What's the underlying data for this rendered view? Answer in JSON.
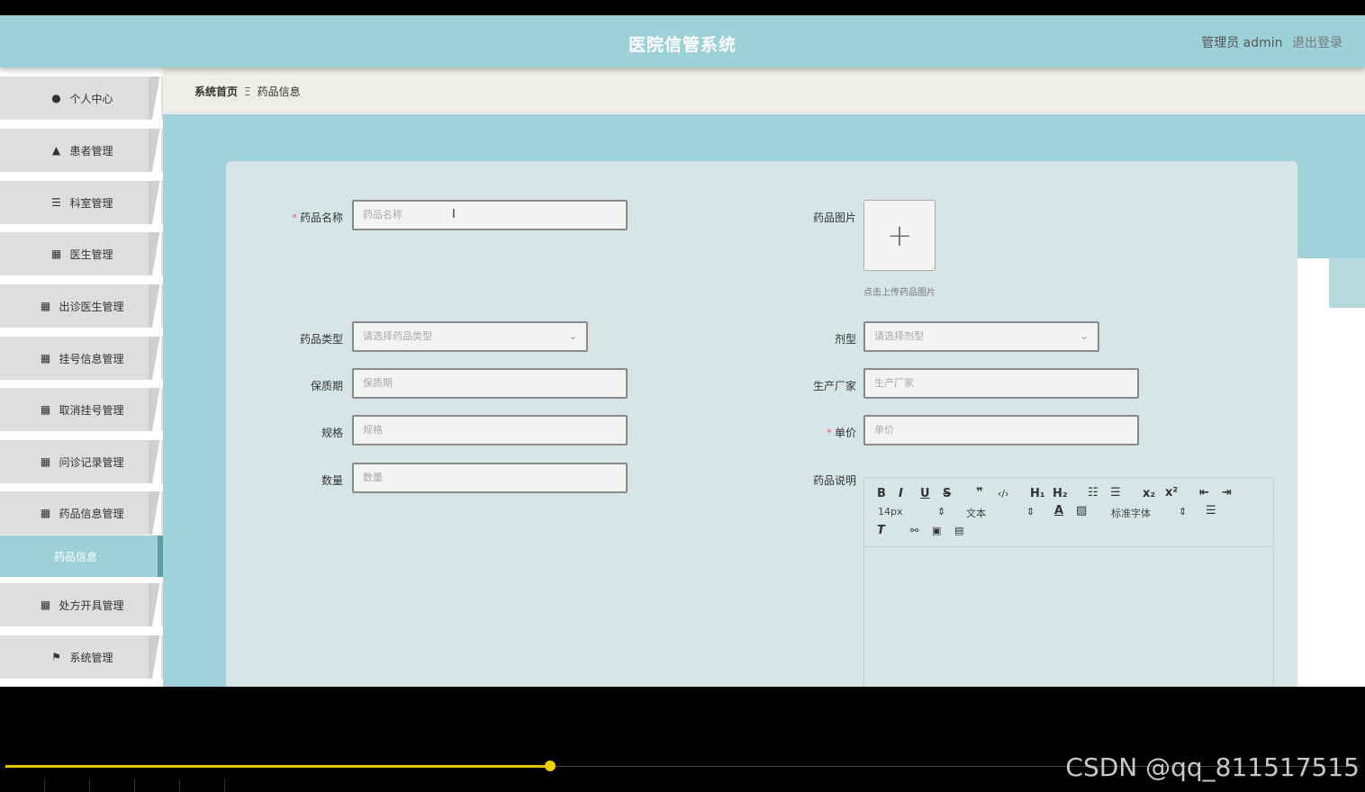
{
  "header": {
    "title": "医院信管系统",
    "user": "管理员 admin",
    "logout": "退出登录"
  },
  "sidebar": {
    "items": [
      {
        "label": "个人中心",
        "icon": "user-icon"
      },
      {
        "label": "患者管理",
        "icon": "user-icon"
      },
      {
        "label": "科室管理",
        "icon": "list-icon"
      },
      {
        "label": "医生管理",
        "icon": "grid-icon"
      },
      {
        "label": "出诊医生管理",
        "icon": "grid-icon"
      },
      {
        "label": "挂号信息管理",
        "icon": "grid-icon"
      },
      {
        "label": "取消挂号管理",
        "icon": "grid-icon"
      },
      {
        "label": "问诊记录管理",
        "icon": "grid-icon"
      },
      {
        "label": "药品信息管理",
        "icon": "grid-icon"
      },
      {
        "label": "处方开具管理",
        "icon": "grid-icon"
      },
      {
        "label": "系统管理",
        "icon": "flag-icon"
      }
    ],
    "active_sub": "药品信息"
  },
  "breadcrumb": {
    "home": "系统首页",
    "separator": "Ξ",
    "current": "药品信息"
  },
  "form": {
    "name_label": "药品名称",
    "name_placeholder": "药品名称",
    "image_label": "药品图片",
    "upload_tip": "点击上传药品图片",
    "type_label": "药品类型",
    "type_placeholder": "请选择药品类型",
    "dosage_label": "剂型",
    "dosage_placeholder": "请选择剂型",
    "shelf_label": "保质期",
    "shelf_placeholder": "保质期",
    "maker_label": "生产厂家",
    "maker_placeholder": "生产厂家",
    "spec_label": "规格",
    "spec_placeholder": "规格",
    "price_label": "单价",
    "price_placeholder": "单价",
    "qty_label": "数量",
    "qty_placeholder": "数量",
    "desc_label": "药品说明",
    "required_mark": "*"
  },
  "editor": {
    "font_size": "14px",
    "text_style": "文本",
    "font_family": "标准字体"
  },
  "watermark": "CSDN @qq_811517515",
  "colors": {
    "accent": "#9dd1d8",
    "required": "#e86a6a"
  }
}
